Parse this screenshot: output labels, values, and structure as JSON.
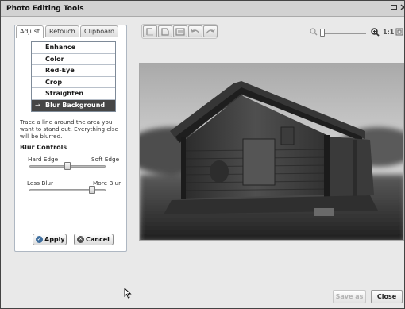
{
  "window": {
    "title": "Photo Editing Tools",
    "minimize_icon": "minimize-icon",
    "close_icon": "close-icon"
  },
  "tabs": [
    {
      "label": "Adjust",
      "active": true
    },
    {
      "label": "Retouch",
      "active": false
    },
    {
      "label": "Clipboard",
      "active": false
    }
  ],
  "menu": {
    "items": [
      {
        "label": "Enhance",
        "selected": false
      },
      {
        "label": "Color",
        "selected": false
      },
      {
        "label": "Red-Eye",
        "selected": false
      },
      {
        "label": "Crop",
        "selected": false
      },
      {
        "label": "Straighten",
        "selected": false
      },
      {
        "label": "Blur Background",
        "selected": true
      }
    ],
    "selected_arrow": "→"
  },
  "instructions": "Trace a line around the area you want to stand out. Everything else will be blurred.",
  "blur_controls": {
    "title": "Blur Controls",
    "edge": {
      "left_label": "Hard Edge",
      "right_label": "Soft Edge",
      "value": 0.5
    },
    "amount": {
      "left_label": "Less Blur",
      "right_label": "More Blur",
      "value": 0.82
    }
  },
  "buttons": {
    "apply": "Apply",
    "cancel": "Cancel",
    "save_as": "Save as",
    "close": "Close"
  },
  "toolbar": {
    "icons": [
      "rotate-left-icon",
      "rotate-right-icon",
      "fit-icon",
      "undo-icon",
      "redo-icon"
    ]
  },
  "zoom": {
    "ratio_label": "1:1",
    "value": 0.05
  },
  "colors": {
    "selected_item_bg": "#464646",
    "panel_border": "#aeb7c2",
    "window_bg": "#e9e9e9"
  }
}
